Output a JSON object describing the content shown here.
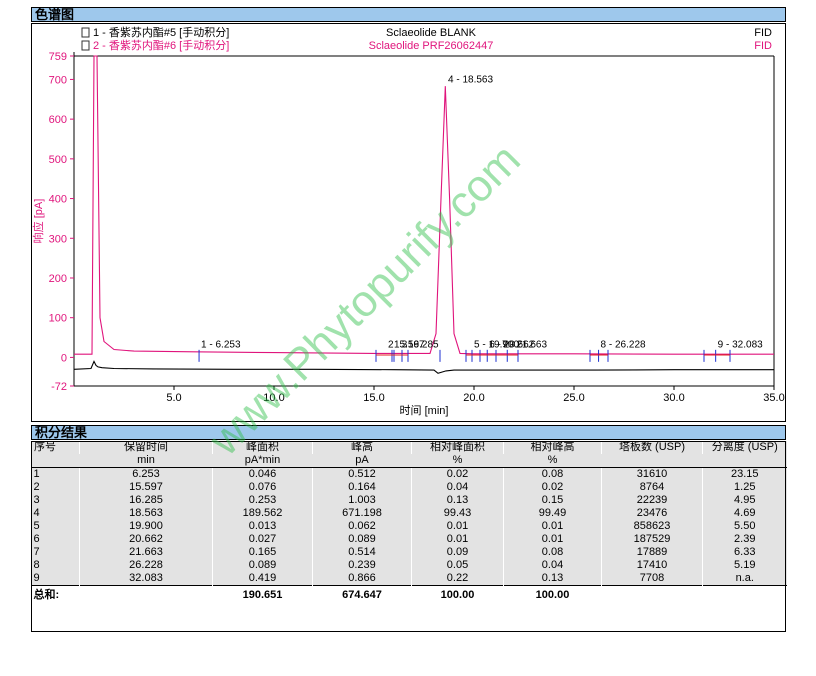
{
  "section_titles": {
    "chromatogram": "色谱图",
    "integration": "积分结果"
  },
  "legend": [
    {
      "label": "1 - 香紫苏内酯#5 [手动积分]",
      "sample": "Sclaeolide BLANK",
      "detector": "FID",
      "color": "#000000"
    },
    {
      "label": "2 - 香紫苏内酯#6 [手动积分]",
      "sample": "Sclaeolide PRF26062447",
      "detector": "FID",
      "color": "#e0147c"
    }
  ],
  "chart_data": {
    "type": "line",
    "xlabel": "时间 [min]",
    "ylabel": "响应 [pA]",
    "xlim": [
      0.0,
      35.0
    ],
    "ylim": [
      -72,
      759
    ],
    "x_ticks": [
      5.0,
      10.0,
      15.0,
      20.0,
      25.0,
      30.0,
      35.0
    ],
    "x_tick_labels": [
      "5.0",
      "10.0",
      "15.0",
      "20.0",
      "25.0",
      "30.0",
      "35.0"
    ],
    "y_ticks": [
      -72,
      0,
      100,
      200,
      300,
      400,
      500,
      600,
      700,
      759
    ],
    "y_tick_labels": [
      "-72",
      "0",
      "100",
      "200",
      "300",
      "400",
      "500",
      "600",
      "700",
      "759"
    ],
    "grid": false,
    "series": [
      {
        "name": "Sclaeolide BLANK",
        "color": "#000000",
        "x": [
          0.0,
          0.85,
          1.0,
          1.1,
          1.2,
          1.4,
          2.0,
          4.0,
          8.0,
          12.0,
          16.0,
          18.0,
          18.2,
          18.6,
          19.0,
          22.0,
          26.0,
          30.0,
          35.0
        ],
        "y": [
          -30,
          -28,
          -10,
          -20,
          -24,
          -26,
          -28,
          -29,
          -30,
          -30,
          -31,
          -32,
          -40,
          -34,
          -32,
          -32,
          -32,
          -31,
          -31
        ]
      },
      {
        "name": "Sclaeolide PRF26062447",
        "color": "#e0147c",
        "x": [
          0.0,
          0.9,
          1.0,
          1.05,
          1.15,
          1.3,
          1.5,
          2.0,
          3.0,
          6.0,
          10.0,
          15.0,
          17.8,
          18.1,
          18.35,
          18.563,
          18.78,
          19.0,
          19.3,
          20.0,
          25.0,
          30.0,
          35.0
        ],
        "y": [
          8,
          8,
          759,
          759,
          759,
          100,
          40,
          20,
          16,
          14,
          12,
          10,
          10,
          60,
          400,
          683,
          400,
          60,
          10,
          9,
          9,
          8,
          8
        ]
      }
    ],
    "peak_labels": [
      {
        "text": "1 - 6.253",
        "x": 6.253,
        "y": 22
      },
      {
        "text": "2",
        "x": 15.597,
        "y": 22
      },
      {
        "text": "3",
        "x": 16.285,
        "y": 22
      },
      {
        "text": "15.597",
        "x": 15.9,
        "y": 22
      },
      {
        "text": "16.285",
        "x": 16.6,
        "y": 22
      },
      {
        "text": "4 - 18.563",
        "x": 18.6,
        "y": 690
      },
      {
        "text": "5 - 19.900",
        "x": 19.9,
        "y": 22
      },
      {
        "text": "6 - 20.662",
        "x": 20.66,
        "y": 22
      },
      {
        "text": "7 - 21.663",
        "x": 21.3,
        "y": 22
      },
      {
        "text": "8 - 26.228",
        "x": 26.228,
        "y": 22
      },
      {
        "text": "9 - 32.083",
        "x": 32.083,
        "y": 22
      }
    ],
    "baseline_marks": [
      6.253,
      15.1,
      15.9,
      16.0,
      16.4,
      16.7,
      18.3,
      19.6,
      19.9,
      20.3,
      20.662,
      21.1,
      21.663,
      22.2,
      25.8,
      26.228,
      26.7,
      31.5,
      32.083,
      32.8
    ]
  },
  "results_table": {
    "headers": [
      {
        "top": "序号",
        "bottom": ""
      },
      {
        "top": "保留时间",
        "bottom": "min"
      },
      {
        "top": "峰面积",
        "bottom": "pA*min"
      },
      {
        "top": "峰高",
        "bottom": "pA"
      },
      {
        "top": "相对峰面积",
        "bottom": "%"
      },
      {
        "top": "相对峰高",
        "bottom": "%"
      },
      {
        "top": "塔板数 (USP)",
        "bottom": ""
      },
      {
        "top": "分离度 (USP)",
        "bottom": ""
      }
    ],
    "rows": [
      [
        "1",
        "6.253",
        "0.046",
        "0.512",
        "0.02",
        "0.08",
        "31610",
        "23.15"
      ],
      [
        "2",
        "15.597",
        "0.076",
        "0.164",
        "0.04",
        "0.02",
        "8764",
        "1.25"
      ],
      [
        "3",
        "16.285",
        "0.253",
        "1.003",
        "0.13",
        "0.15",
        "22239",
        "4.95"
      ],
      [
        "4",
        "18.563",
        "189.562",
        "671.198",
        "99.43",
        "99.49",
        "23476",
        "4.69"
      ],
      [
        "5",
        "19.900",
        "0.013",
        "0.062",
        "0.01",
        "0.01",
        "858623",
        "5.50"
      ],
      [
        "6",
        "20.662",
        "0.027",
        "0.089",
        "0.01",
        "0.01",
        "187529",
        "2.39"
      ],
      [
        "7",
        "21.663",
        "0.165",
        "0.514",
        "0.09",
        "0.08",
        "17889",
        "6.33"
      ],
      [
        "8",
        "26.228",
        "0.089",
        "0.239",
        "0.05",
        "0.04",
        "17410",
        "5.19"
      ],
      [
        "9",
        "32.083",
        "0.419",
        "0.866",
        "0.22",
        "0.13",
        "7708",
        "n.a."
      ]
    ],
    "total": [
      "总和:",
      "",
      "190.651",
      "674.647",
      "100.00",
      "100.00",
      "",
      ""
    ]
  },
  "watermark": "www.Phytopurify.com"
}
